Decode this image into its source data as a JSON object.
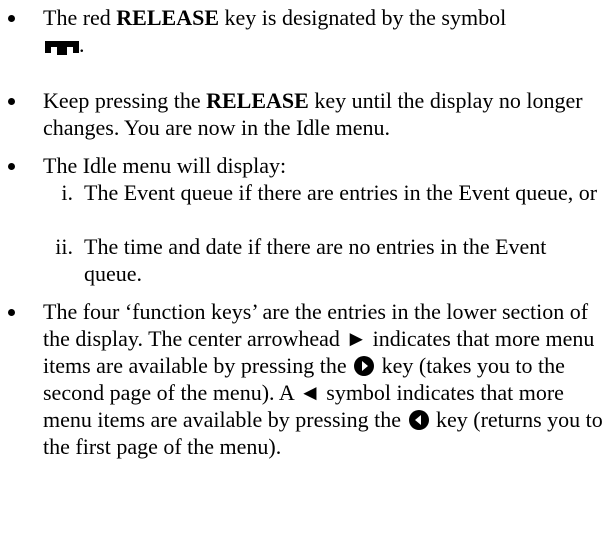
{
  "b1": {
    "p1": "The red ",
    "key": "RELEASE",
    "p2": " key is designated by the symbol",
    "p3": "."
  },
  "b2": {
    "p1": "Keep pressing the ",
    "key": "RELEASE",
    "p2": " key until the display no longer changes. You are now in the Idle menu."
  },
  "b3": {
    "text": "The Idle menu will display:",
    "items": [
      {
        "num": "i.",
        "text": "The Event queue if there are entries in the Event queue, or"
      },
      {
        "num": "ii.",
        "text": "The time and date if there are no entries in the Event queue."
      }
    ]
  },
  "b4": {
    "p1": "The four ‘function keys’ are the entries in the lower section of the display. The center arrowhead ► indicates that more menu items are available by pressing the",
    "p2": "key (takes you to the second page of the menu). A ◄ symbol indicates that more menu items are available by pressing the",
    "p3": "key (returns you to the first page of the menu)."
  },
  "icons": {
    "release": "release-key-icon",
    "right": "right-arrow-key-icon",
    "left": "left-arrow-key-icon"
  }
}
